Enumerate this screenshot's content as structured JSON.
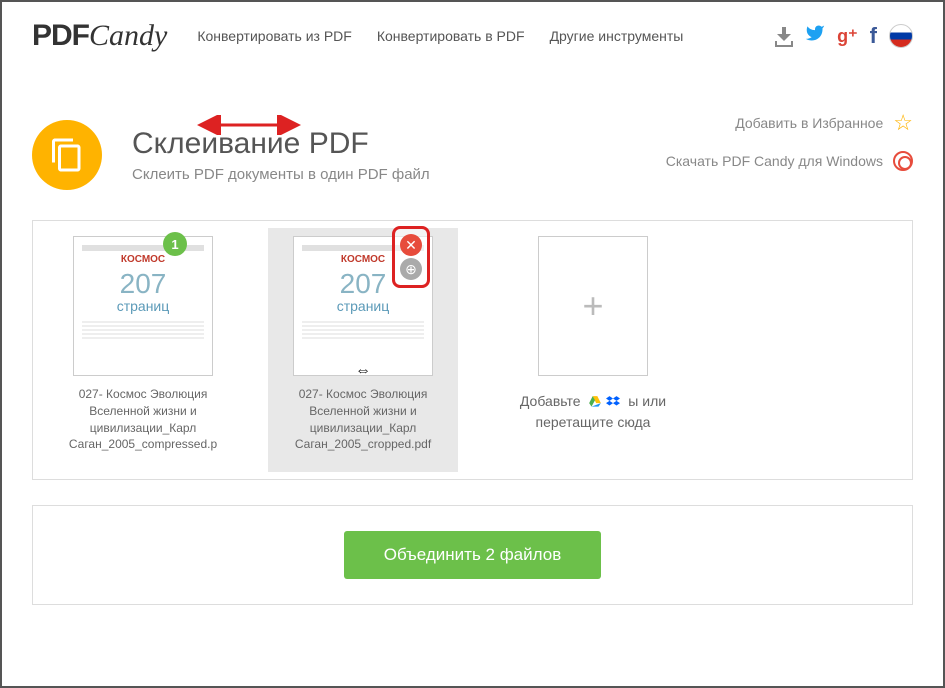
{
  "logo": {
    "pdf": "PDF",
    "candy": "Candy"
  },
  "nav": {
    "convert_from": "Конвертировать из PDF",
    "convert_to": "Конвертировать в PDF",
    "other_tools": "Другие инструменты"
  },
  "title": {
    "heading": "Склеивание PDF",
    "subtitle": "Склеить PDF документы в один PDF файл"
  },
  "side": {
    "favorites": "Добавить в Избранное",
    "download": "Скачать PDF Candy для Windows"
  },
  "files": [
    {
      "badge": "1",
      "thumb_title": "КОСМОС",
      "pages_num": "207",
      "pages_label": "страниц",
      "name": "027- Космос Эволюция Вселенной жизни и цивилизации_Карл Саган_2005_compressed.p"
    },
    {
      "thumb_title": "КОСМОС",
      "pages_num": "207",
      "pages_label": "страниц",
      "name": "027- Космос Эволюция Вселенной жизни и цивилизации_Карл Саган_2005_cropped.pdf"
    }
  ],
  "dropzone": {
    "plus": "+",
    "line1_a": "Добавьте",
    "line1_b": "ы или",
    "line2": "перетащите сюда"
  },
  "action": {
    "merge_button": "Объединить 2 файлов"
  }
}
